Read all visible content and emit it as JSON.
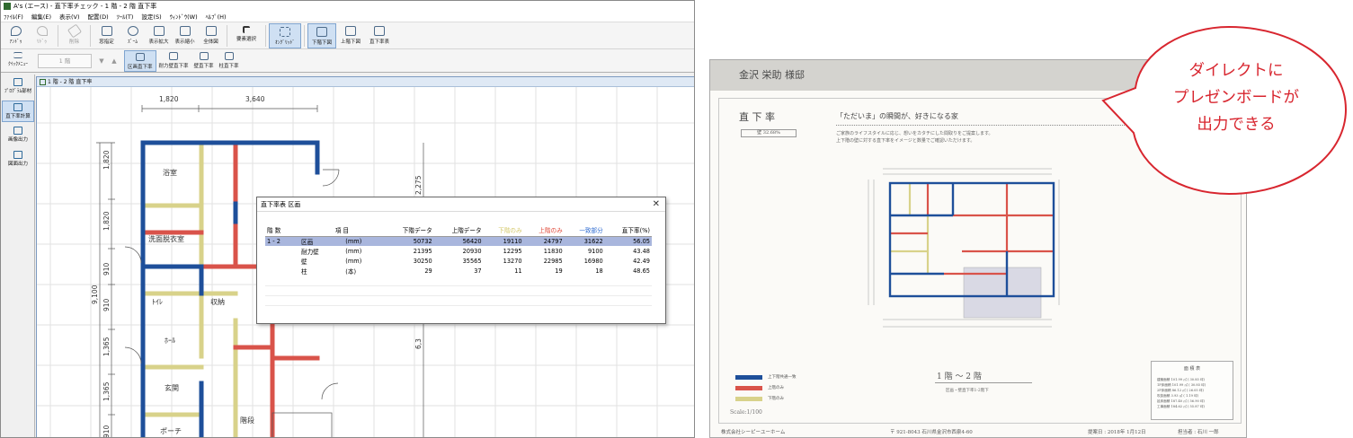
{
  "app": {
    "title": "A's (エース) - 直下率チェック - 1 階 - 2 階  直下率",
    "menus": [
      "ﾌｧｲﾙ(F)",
      "編集(E)",
      "表示(V)",
      "配置(D)",
      "ﾂｰﾙ(T)",
      "設定(S)",
      "ｳｨﾝﾄﾞｳ(W)",
      "ﾍﾙﾌﾟ(H)"
    ],
    "toolbar1": [
      {
        "label": "ｱﾝﾄﾞｩ",
        "state": "normal"
      },
      {
        "label": "ﾘﾄﾞｩ",
        "state": "gray"
      },
      {
        "label": "削除",
        "state": "gray"
      },
      {
        "label": "窓指定",
        "state": "normal"
      },
      {
        "label": "ｽﾞｰﾑ",
        "state": "normal"
      },
      {
        "label": "表示拡大",
        "state": "normal"
      },
      {
        "label": "表示縮小",
        "state": "normal"
      },
      {
        "label": "全体図",
        "state": "normal"
      },
      {
        "label": "要素選択",
        "state": "normal"
      },
      {
        "label": "ｵﾝｸﾞﾘｯﾄﾞ",
        "state": "active"
      },
      {
        "label": "下階下図",
        "state": "active"
      },
      {
        "label": "上階下図",
        "state": "normal"
      },
      {
        "label": "直下率表",
        "state": "normal"
      }
    ],
    "quick_menu_label": "ｸｲｯｸﾒﾆｭｰ",
    "floor_selector": "1 階",
    "toolbar2": [
      {
        "label": "区画直下率",
        "state": "active"
      },
      {
        "label": "耐力壁直下率",
        "state": "normal"
      },
      {
        "label": "壁直下率",
        "state": "normal"
      },
      {
        "label": "柱直下率",
        "state": "normal"
      }
    ],
    "sidebar": [
      {
        "label": "ﾌﾟﾛｸﾞﾗﾑ部材",
        "state": "normal"
      },
      {
        "label": "直下率計算",
        "state": "active"
      },
      {
        "label": "画像出力",
        "state": "normal"
      },
      {
        "label": "図面出力",
        "state": "normal"
      }
    ],
    "doc_title": "1 階 - 2 階  直下率",
    "plan": {
      "dims_top": [
        "1,820",
        "3,640"
      ],
      "dims_left": [
        "1,820",
        "1,820",
        "910",
        "910",
        "1,365",
        "1,365",
        "910"
      ],
      "dim_total_left": "9,100",
      "dim_right": "2,275",
      "dim_right2": "6,3",
      "rooms": [
        "浴室",
        "洗面脱衣室",
        "ﾄｲﾚ",
        "収納",
        "ﾎｰﾙ",
        "玄関",
        "ポーチ",
        "階段"
      ]
    }
  },
  "dialog": {
    "title": "直下率表  区画",
    "close": "✕",
    "headers": [
      "階 数",
      "項 目",
      "下階データ",
      "上階データ",
      "下階のみ",
      "上階のみ",
      "一致部分",
      "直下率(%)"
    ],
    "header_colors": [
      "#000000",
      "#000000",
      "#000000",
      "#000000",
      "#c9c070",
      "#e04a3a",
      "#2e6bd0",
      "#000000"
    ],
    "rows": [
      {
        "floor": "1 - 2",
        "item": "区画",
        "unit": "(mm)",
        "lower": "50732",
        "upper": "56420",
        "lower_only": "19110",
        "upper_only": "24797",
        "match": "31622",
        "rate": "56.05"
      },
      {
        "floor": "",
        "item": "耐力壁",
        "unit": "(mm)",
        "lower": "21395",
        "upper": "20930",
        "lower_only": "12295",
        "upper_only": "11830",
        "match": "9100",
        "rate": "43.48"
      },
      {
        "floor": "",
        "item": "壁",
        "unit": "(mm)",
        "lower": "30250",
        "upper": "35565",
        "lower_only": "13270",
        "upper_only": "22985",
        "match": "16980",
        "rate": "42.49"
      },
      {
        "floor": "",
        "item": "柱",
        "unit": "(本)",
        "lower": "29",
        "upper": "37",
        "lower_only": "11",
        "upper_only": "19",
        "match": "18",
        "rate": "48.65"
      }
    ]
  },
  "board": {
    "client": "金沢 栄助  様邸",
    "section": "直  下  率",
    "rate_badge": "壁 32.68%",
    "headline": "「ただいま」の瞬間が、好きになる家",
    "lead1": "ご家族のライフスタイルに応じ、想いをカタチにした間取りをご提案します。",
    "lead2": "上下階の壁に対する直下率をイメージと数量でご確認いただけます。",
    "legend": [
      "上下階共通一致",
      "上階のみ",
      "下階のみ"
    ],
    "legend_colors": [
      "#1e4f9a",
      "#d9534a",
      "#d8d28a"
    ],
    "floor_label": "1 階 ～ 2 階",
    "floor_sub": "区画・壁直下率1-2階下",
    "scale": "Scale:1/100",
    "area_table_title": "面 積 表",
    "area_rows": [
      "建築面積  101.99 ㎡ ( 30.85 坪)",
      "1F床面積  101.99 ㎡ ( 30.85 坪)",
      "2F床面積   86.12 ㎡ ( 26.05 坪)",
      "吹抜面積    3.93 ㎡ (  1.19 坪)",
      "延床面積  187.40 ㎡ ( 56.90 坪)",
      "工事面積  184.62 ㎡ ( 55.87 坪)"
    ],
    "company": "株式会社シーピーユーホーム",
    "address": "〒 921-8043   石川県金沢市西泉4-60",
    "date": "提案日 : 2018年 1月12日",
    "staff": "担当者 : 石川  一郎"
  },
  "callout": {
    "lines": [
      "ダイレクトに",
      "プレゼンボードが",
      "出力できる"
    ],
    "color": "#d8262f"
  },
  "colors": {
    "upper_only": "#d9534a",
    "lower_only": "#d8d28a",
    "match": "#1e4f9a"
  }
}
